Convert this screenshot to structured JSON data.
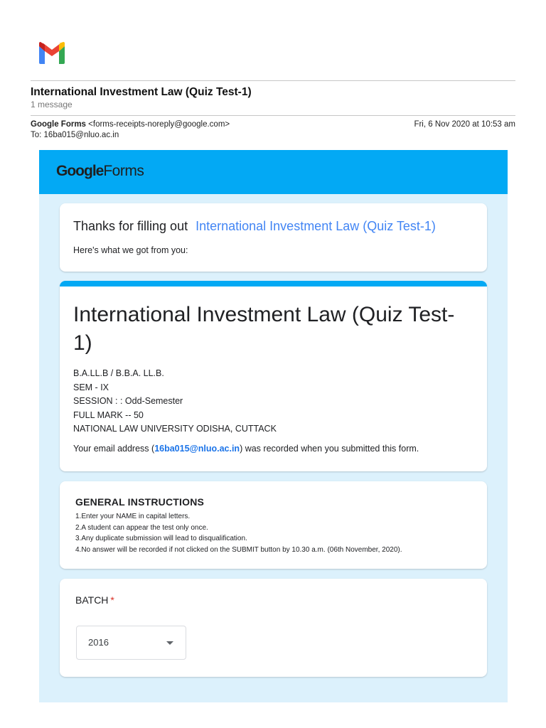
{
  "email": {
    "subject": "International Investment Law (Quiz Test-1)",
    "message_count": "1 message",
    "sender_name": "Google Forms",
    "sender_address": "<forms-receipts-noreply@google.com>",
    "to_line": "To: 16ba015@nluo.ac.in",
    "date": "Fri, 6 Nov 2020 at 10:53 am",
    "logo_icon": "gmail-logo-icon"
  },
  "forms": {
    "brand_google": "Google",
    "brand_forms": "Forms",
    "header_color": "#03a9f4",
    "body_bg_color": "#dcf1fc",
    "thanks_prefix": "Thanks for filling out",
    "thanks_link": "International Investment Law (Quiz Test-1)",
    "got_from_you": "Here's what we got from you:",
    "form_title": "International Investment Law (Quiz Test-1)",
    "description_lines": [
      "B.A.LL.B / B.B.A. LL.B.",
      "SEM - IX",
      "SESSION : : Odd-Semester",
      "FULL MARK -- 50",
      "NATIONAL LAW UNIVERSITY ODISHA, CUTTACK"
    ],
    "email_note_prefix": "Your email address (",
    "email_note_address": "16ba015@nluo.ac.in",
    "email_note_suffix": ") was recorded when you submitted this form.",
    "instructions_title": "GENERAL INSTRUCTIONS",
    "instructions": [
      "1.Enter your NAME in capital letters.",
      "2.A student can appear the test only once.",
      "3.Any duplicate submission will lead to disqualification.",
      "4.No answer will be recorded if not clicked on the SUBMIT button by 10.30 a.m. (06th November, 2020)."
    ],
    "batch_label": "BATCH",
    "required_mark": "*",
    "batch_value": "2016"
  }
}
